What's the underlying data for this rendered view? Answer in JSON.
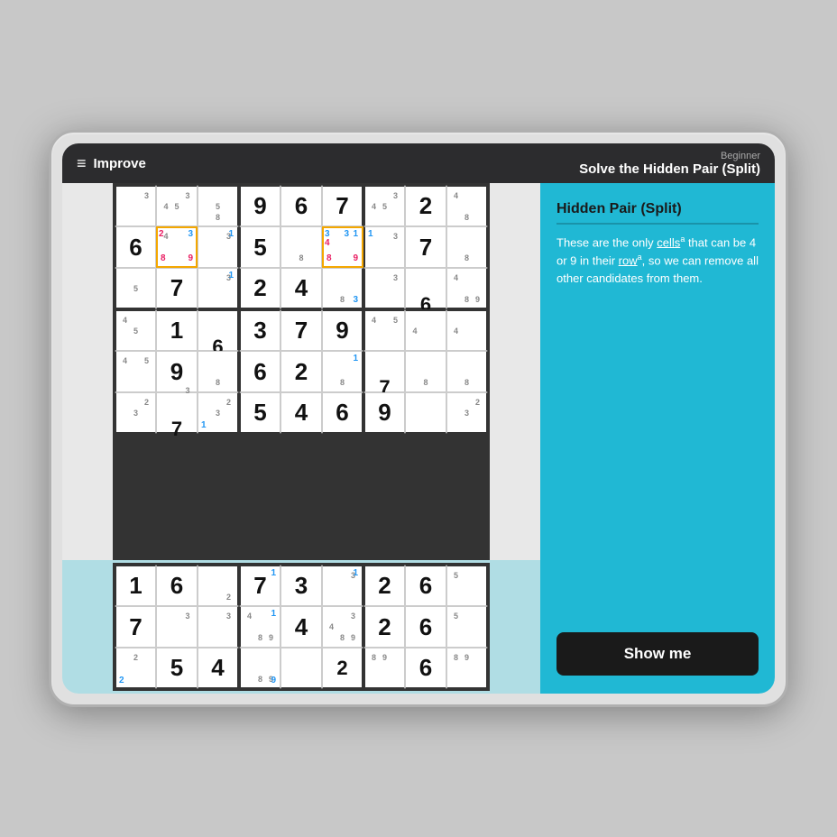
{
  "header": {
    "menu_icon": "≡",
    "app_name": "Improve",
    "difficulty": "Beginner",
    "title": "Solve the Hidden Pair (Split)"
  },
  "side_panel": {
    "hint_title": "Hidden Pair (Split)",
    "hint_text_1": "These are the only ",
    "hint_cells_link": "cells",
    "hint_text_2": " that can be 4 or 9 in their ",
    "hint_row_link": "row",
    "hint_text_3": ", so we can remove all other candidates from them.",
    "show_me_label": "Show me"
  }
}
